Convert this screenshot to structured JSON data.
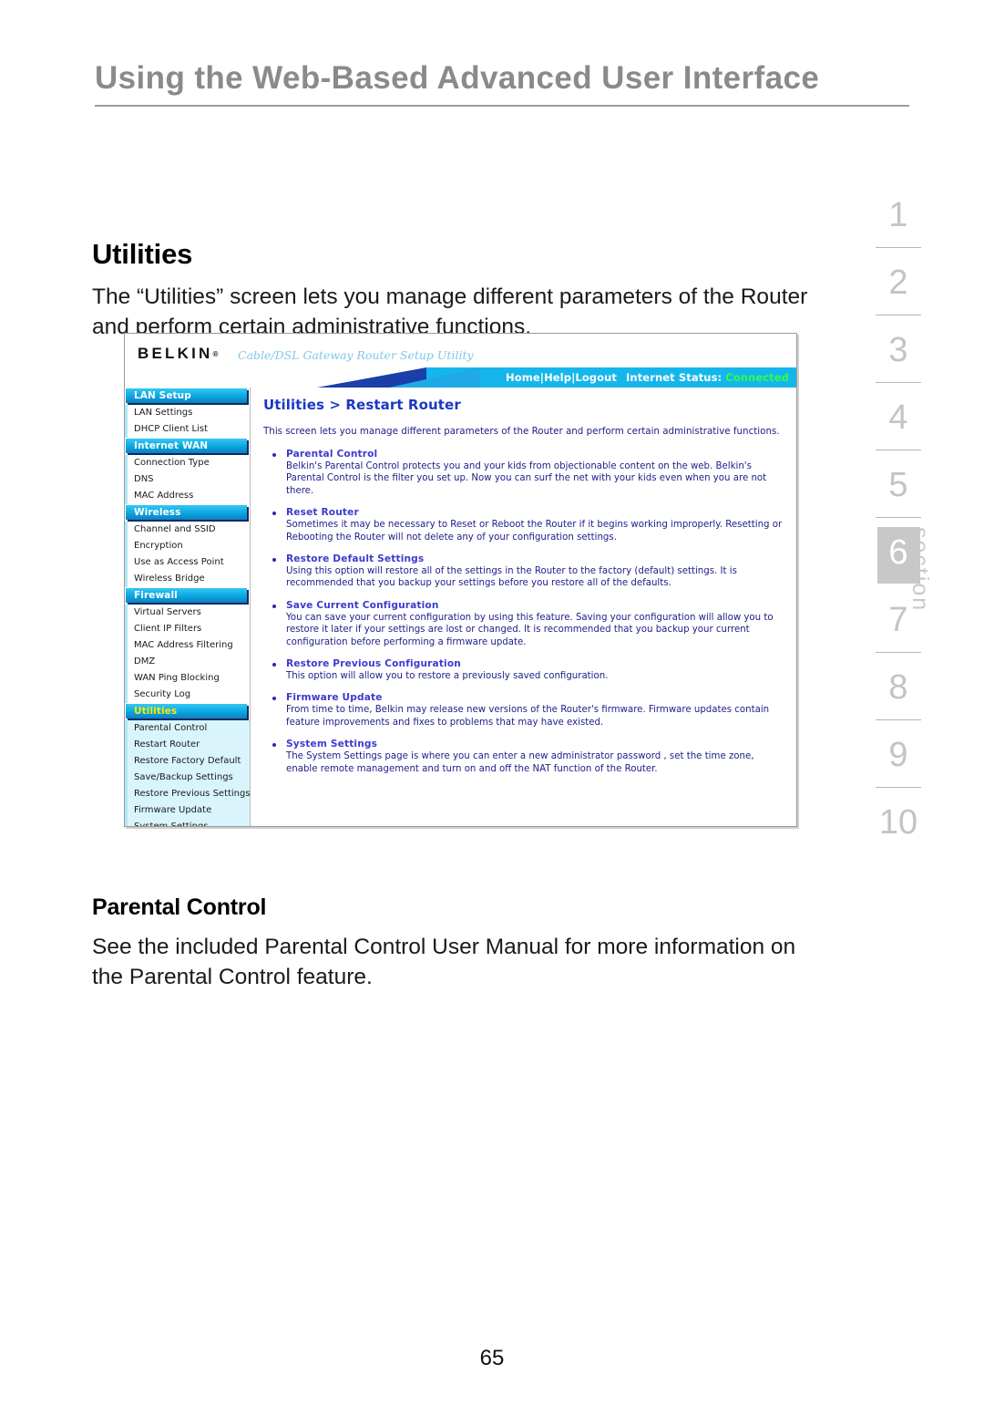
{
  "running_head": "Using the Web-Based Advanced User Interface",
  "section_rail": {
    "numbers": [
      "1",
      "2",
      "3",
      "4",
      "5",
      "6",
      "7",
      "8",
      "9",
      "10"
    ],
    "active": "6",
    "label": "section"
  },
  "utilities": {
    "heading": "Utilities",
    "intro": "The “Utilities” screen lets you manage different parameters of the Router and perform certain administrative functions."
  },
  "parental": {
    "heading": "Parental Control",
    "copy": "See the included Parental Control User Manual for more information on the Parental Control feature."
  },
  "screenshot": {
    "brand": "BELKIN",
    "brand_reg": "®",
    "tagline": "Cable/DSL Gateway Router Setup Utility",
    "nav": {
      "home": "Home",
      "help": "Help",
      "logout": "Logout",
      "separator": "|",
      "status_label": "Internet Status:",
      "status_value": "Connected",
      "status_color": "#2dff4a"
    },
    "sidebar": [
      {
        "header": "LAN Setup",
        "active": false,
        "items": [
          "LAN Settings",
          "DHCP Client List"
        ]
      },
      {
        "header": "Internet WAN",
        "active": false,
        "items": [
          "Connection Type",
          "DNS",
          "MAC Address"
        ]
      },
      {
        "header": "Wireless",
        "active": false,
        "items": [
          "Channel and SSID",
          "Encryption",
          "Use as Access Point",
          "Wireless Bridge"
        ]
      },
      {
        "header": "Firewall",
        "active": false,
        "items": [
          "Virtual Servers",
          "Client IP Filters",
          "MAC Address Filtering",
          "DMZ",
          "WAN Ping Blocking",
          "Security Log"
        ]
      },
      {
        "header": "Utilities",
        "active": true,
        "items": [
          "Parental Control",
          "Restart Router",
          "Restore Factory Default",
          "Save/Backup Settings",
          "Restore Previous Settings",
          "Firmware Update",
          "System Settings"
        ]
      }
    ],
    "main": {
      "title": "Utilities > Restart Router",
      "intro": "This screen lets you manage different parameters of the Router and perform certain administrative functions.",
      "bullets": [
        {
          "title": "Parental Control",
          "text": "Belkin's Parental Control protects you and your kids from objectionable content on the web. Belkin's Parental Control is the filter you set up. Now you can surf the net with your kids even when you are not there."
        },
        {
          "title": "Reset Router",
          "text": "Sometimes it may be necessary to Reset or Reboot the Router if it begins working improperly. Resetting or Rebooting the Router will not delete any of your configuration settings."
        },
        {
          "title": "Restore Default Settings",
          "text": "Using this option will restore all of the settings in the Router to the factory (default) settings. It is recommended that you backup your settings before you restore all of the defaults."
        },
        {
          "title": "Save Current Configuration",
          "text": "You can save your current configuration by using this feature. Saving your configuration will allow you to restore it later if your settings are lost or changed. It is recommended that you backup your current configuration before performing a firmware update."
        },
        {
          "title": "Restore Previous Configuration",
          "text": "This option will allow you to restore a previously saved configuration."
        },
        {
          "title": "Firmware Update",
          "text": "From time to time, Belkin may release new versions of the Router's firmware. Firmware updates contain feature improvements and fixes to problems that may have existed."
        },
        {
          "title": "System Settings",
          "text": "The System Settings page is where you can enter a new administrator password , set the time zone, enable remote management and turn on and off the NAT function of the Router."
        }
      ]
    }
  },
  "folio": "65"
}
